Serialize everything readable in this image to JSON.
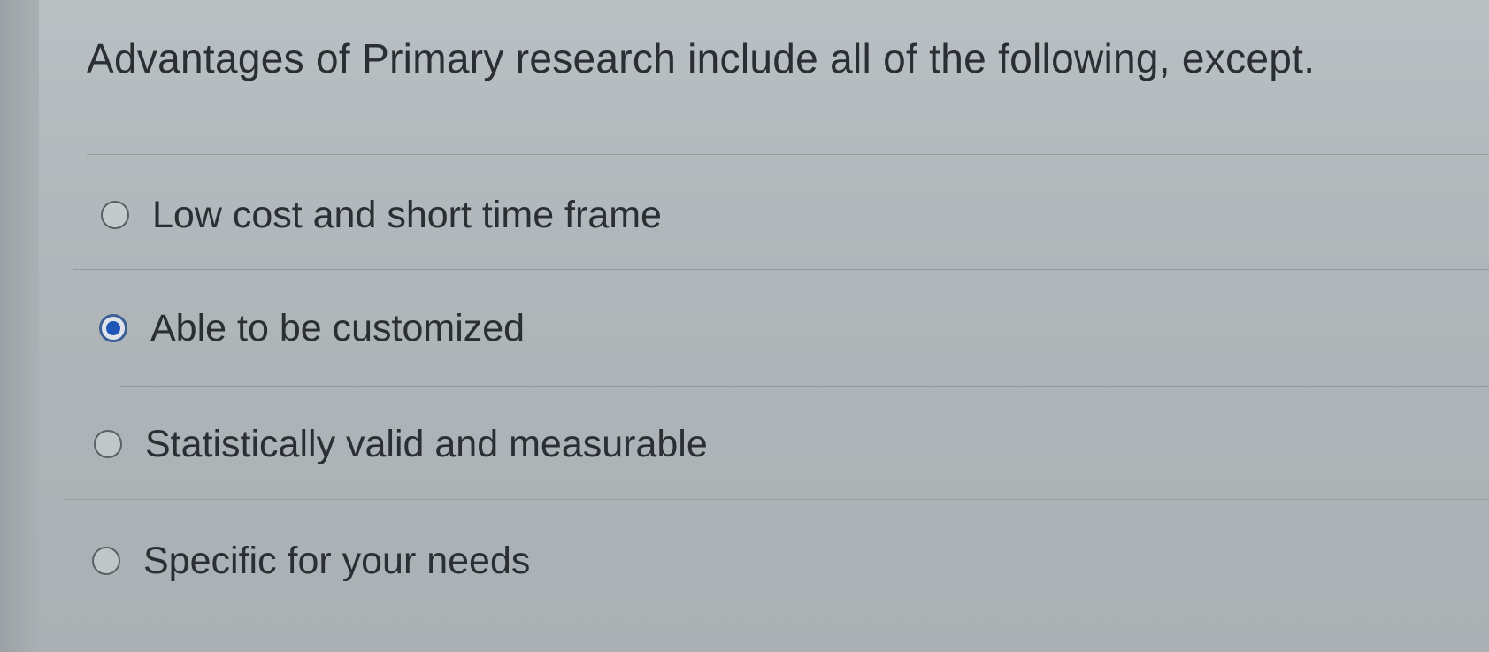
{
  "question": {
    "text": "Advantages of Primary research include all of the following, except."
  },
  "options": [
    {
      "label": "Low cost and short time frame",
      "selected": false
    },
    {
      "label": "Able to be customized",
      "selected": true
    },
    {
      "label": "Statistically valid and measurable",
      "selected": false
    },
    {
      "label": "Specific for your needs",
      "selected": false
    }
  ],
  "colors": {
    "background": "#b1b9bc",
    "text": "#2b2e33",
    "radio_selected": "#1f56b8",
    "divider": "#8f9699"
  }
}
